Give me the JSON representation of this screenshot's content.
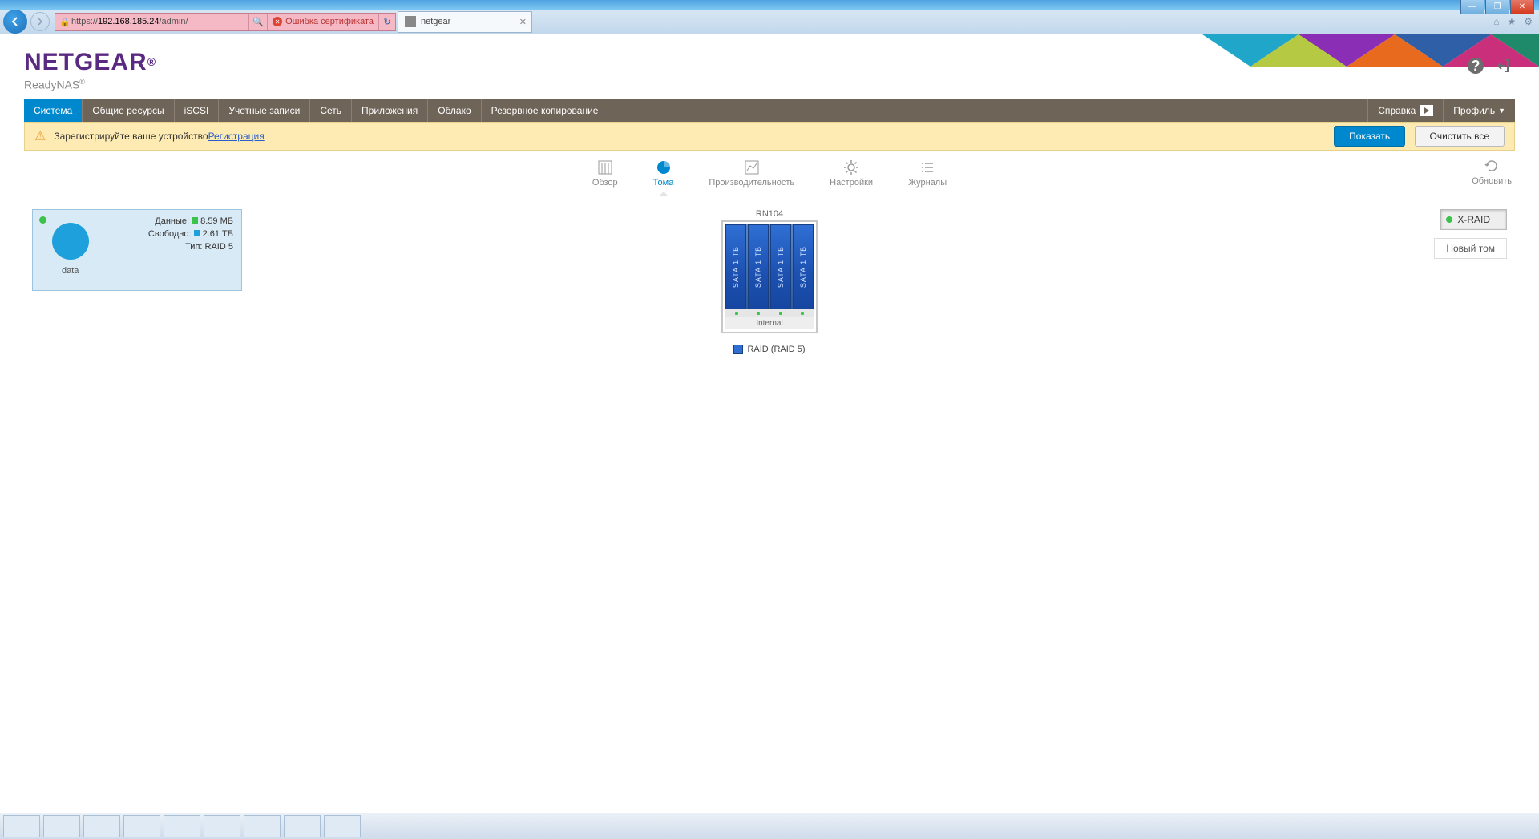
{
  "window": {
    "min": "—",
    "max": "❐",
    "close": "✕"
  },
  "browser": {
    "url_prefix": "https://",
    "url_host": "192.168.185.24",
    "url_path": "/admin/",
    "cert_error": "Ошибка сертификата",
    "tab_title": "netgear"
  },
  "header": {
    "brand": "NETGEAR",
    "product": "ReadyNAS"
  },
  "nav": {
    "items": [
      "Система",
      "Общие ресурсы",
      "iSCSI",
      "Учетные записи",
      "Сеть",
      "Приложения",
      "Облако",
      "Резервное копирование"
    ],
    "help": "Справка",
    "profile": "Профиль"
  },
  "alert": {
    "text": "Зарегистрируйте ваше устройство ",
    "link": "Регистрация",
    "show": "Показать",
    "clear": "Очистить все"
  },
  "subtabs": {
    "overview": "Обзор",
    "volumes": "Тома",
    "performance": "Производительность",
    "settings": "Настройки",
    "logs": "Журналы",
    "refresh": "Обновить"
  },
  "volume": {
    "name": "data",
    "data_label": "Данные:",
    "data_value": "8.59 МБ",
    "free_label": "Свободно:",
    "free_value": "2.61 ТБ",
    "type_label": "Тип:",
    "type_value": "RAID 5"
  },
  "enclosure": {
    "model": "RN104",
    "bay_label": "SATA 1 ТБ",
    "caption": "Internal",
    "legend": "RAID (RAID 5)"
  },
  "right": {
    "xraid": "X-RAID",
    "newvol": "Новый том"
  }
}
